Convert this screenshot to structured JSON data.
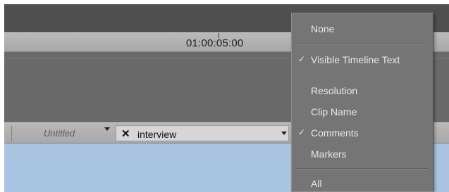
{
  "timeline": {
    "timecode": "01:00:05:00"
  },
  "tabs": {
    "untitled_label": "Untitled",
    "interview_label": "interview",
    "close_glyph": "✕"
  },
  "menu": {
    "check_glyph": "✓",
    "items": [
      {
        "label": "None",
        "checked": false
      },
      {
        "label": "Visible Timeline Text",
        "checked": true
      },
      {
        "label": "Resolution",
        "checked": false
      },
      {
        "label": "Clip Name",
        "checked": false
      },
      {
        "label": "Comments",
        "checked": true
      },
      {
        "label": "Markers",
        "checked": false
      },
      {
        "label": "All",
        "checked": false
      }
    ]
  },
  "colors": {
    "content_bg": "#a9c4e1",
    "menu_bg": "#757575"
  }
}
